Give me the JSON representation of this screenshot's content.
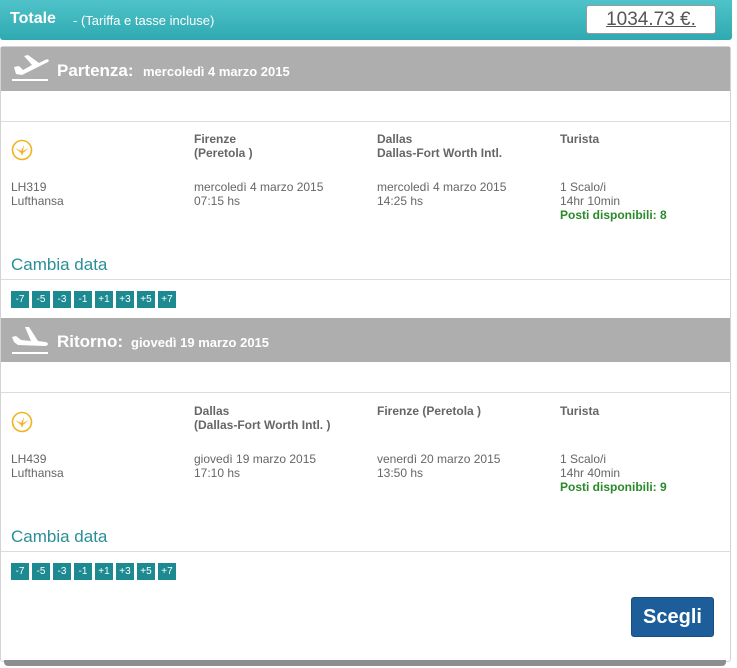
{
  "header": {
    "total_label": "Totale",
    "total_sub": "- (Tariffa e tasse incluse)",
    "price": "1034.73 €."
  },
  "outbound": {
    "title": "Partenza:",
    "date": "mercoledì 4 marzo 2015",
    "from_city": "Firenze",
    "from_airport": "(Peretola )",
    "to_city": "Dallas",
    "to_airport": "Dallas-Fort Worth Intl.",
    "cabin": "Turista",
    "flight_number": "LH319",
    "airline": "Lufthansa",
    "depart_date": "mercoledì 4 marzo 2015",
    "depart_time": "07:15 hs",
    "arrive_date": "mercoledì 4 marzo 2015",
    "arrive_time": "14:25 hs",
    "stops": "1 Scalo/i",
    "duration": "14hr 10min",
    "seats": "Posti disponibili: 8",
    "change_date": "Cambia data",
    "day_offsets": [
      "-7",
      "-5",
      "-3",
      "-1",
      "+1",
      "+3",
      "+5",
      "+7"
    ]
  },
  "return": {
    "title": "Ritorno:",
    "date": "giovedì 19 marzo 2015",
    "from_city": "Dallas",
    "from_airport": "(Dallas-Fort Worth Intl. )",
    "to_airport": "Firenze (Peretola )",
    "cabin": "Turista",
    "flight_number": "LH439",
    "airline": "Lufthansa",
    "depart_date": "giovedì 19 marzo 2015",
    "depart_time": "17:10 hs",
    "arrive_date": "venerdì 20 marzo 2015",
    "arrive_time": "13:50 hs",
    "stops": "1 Scalo/i",
    "duration": "14hr 40min",
    "seats": "Posti disponibili: 9",
    "change_date": "Cambia data",
    "day_offsets": [
      "-7",
      "-5",
      "-3",
      "-1",
      "+1",
      "+3",
      "+5",
      "+7"
    ]
  },
  "actions": {
    "choose": "Scegli"
  },
  "colors": {
    "header_teal": "#2fa9b1",
    "section_gray": "#aeaeae",
    "day_button": "#1d8a92",
    "choose_button": "#1d5d9a",
    "seats_green": "#2a8a2a",
    "lufthansa_yellow": "#f0b323"
  }
}
